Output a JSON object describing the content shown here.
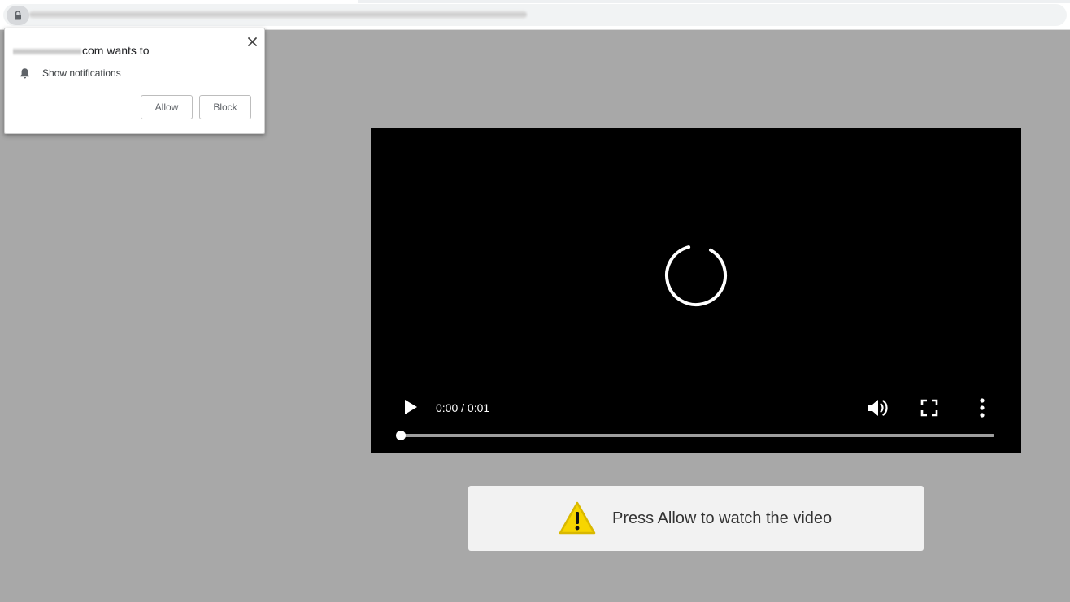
{
  "browser": {
    "url_text": ""
  },
  "permission_popup": {
    "title_suffix": "com wants to",
    "permission_label": "Show notifications",
    "allow_label": "Allow",
    "block_label": "Block",
    "close_glyph": "✕"
  },
  "video_player": {
    "time_display": "0:00 / 0:01",
    "progress": 0.0,
    "state": "loading",
    "icons": [
      "play-icon",
      "volume-icon",
      "fullscreen-icon",
      "more-options-icon",
      "loading-spinner"
    ]
  },
  "notice": {
    "message": "Press Allow to watch the video",
    "icon": "warning-icon",
    "icon_color": "#f7d500"
  },
  "colors": {
    "page_background": "#a8a8a8",
    "video_background": "#000000",
    "notice_background": "#f2f2f2"
  }
}
